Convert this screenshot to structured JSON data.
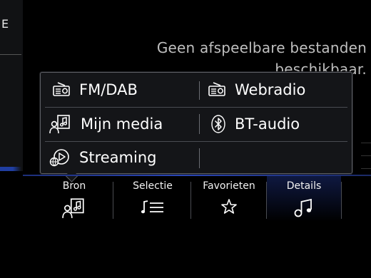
{
  "sidebar": {
    "label": "E"
  },
  "message": "Geen afspeelbare bestanden beschikbaar.",
  "source_popup": {
    "options": [
      {
        "id": "fmdab",
        "label": "FM/DAB",
        "icon": "radio-icon"
      },
      {
        "id": "webradio",
        "label": "Webradio",
        "icon": "radio-icon"
      },
      {
        "id": "mijnmedia",
        "label": "Mijn media",
        "icon": "media-person-icon"
      },
      {
        "id": "btaudio",
        "label": "BT-audio",
        "icon": "bluetooth-icon"
      },
      {
        "id": "streaming",
        "label": "Streaming",
        "icon": "streaming-icon"
      }
    ]
  },
  "tabs": [
    {
      "label": "Bron",
      "icon": "media-person-icon"
    },
    {
      "label": "Selectie",
      "icon": "playlist-icon"
    },
    {
      "label": "Favorieten",
      "icon": "star-icon"
    },
    {
      "label": "Details",
      "icon": "music-note-icon"
    }
  ],
  "colors": {
    "accent": "#2a46b8",
    "popup_bg": "#141518"
  }
}
